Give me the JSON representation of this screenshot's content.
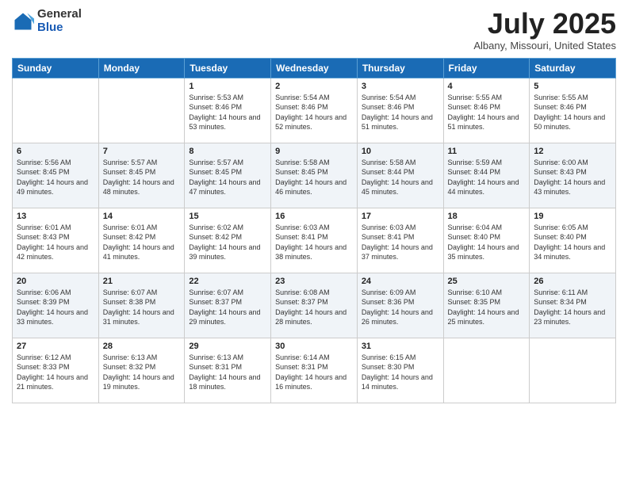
{
  "header": {
    "logo_general": "General",
    "logo_blue": "Blue",
    "month_title": "July 2025",
    "location": "Albany, Missouri, United States"
  },
  "days_of_week": [
    "Sunday",
    "Monday",
    "Tuesday",
    "Wednesday",
    "Thursday",
    "Friday",
    "Saturday"
  ],
  "weeks": [
    [
      {
        "day": "",
        "sunrise": "",
        "sunset": "",
        "daylight": ""
      },
      {
        "day": "",
        "sunrise": "",
        "sunset": "",
        "daylight": ""
      },
      {
        "day": "1",
        "sunrise": "Sunrise: 5:53 AM",
        "sunset": "Sunset: 8:46 PM",
        "daylight": "Daylight: 14 hours and 53 minutes."
      },
      {
        "day": "2",
        "sunrise": "Sunrise: 5:54 AM",
        "sunset": "Sunset: 8:46 PM",
        "daylight": "Daylight: 14 hours and 52 minutes."
      },
      {
        "day": "3",
        "sunrise": "Sunrise: 5:54 AM",
        "sunset": "Sunset: 8:46 PM",
        "daylight": "Daylight: 14 hours and 51 minutes."
      },
      {
        "day": "4",
        "sunrise": "Sunrise: 5:55 AM",
        "sunset": "Sunset: 8:46 PM",
        "daylight": "Daylight: 14 hours and 51 minutes."
      },
      {
        "day": "5",
        "sunrise": "Sunrise: 5:55 AM",
        "sunset": "Sunset: 8:46 PM",
        "daylight": "Daylight: 14 hours and 50 minutes."
      }
    ],
    [
      {
        "day": "6",
        "sunrise": "Sunrise: 5:56 AM",
        "sunset": "Sunset: 8:45 PM",
        "daylight": "Daylight: 14 hours and 49 minutes."
      },
      {
        "day": "7",
        "sunrise": "Sunrise: 5:57 AM",
        "sunset": "Sunset: 8:45 PM",
        "daylight": "Daylight: 14 hours and 48 minutes."
      },
      {
        "day": "8",
        "sunrise": "Sunrise: 5:57 AM",
        "sunset": "Sunset: 8:45 PM",
        "daylight": "Daylight: 14 hours and 47 minutes."
      },
      {
        "day": "9",
        "sunrise": "Sunrise: 5:58 AM",
        "sunset": "Sunset: 8:45 PM",
        "daylight": "Daylight: 14 hours and 46 minutes."
      },
      {
        "day": "10",
        "sunrise": "Sunrise: 5:58 AM",
        "sunset": "Sunset: 8:44 PM",
        "daylight": "Daylight: 14 hours and 45 minutes."
      },
      {
        "day": "11",
        "sunrise": "Sunrise: 5:59 AM",
        "sunset": "Sunset: 8:44 PM",
        "daylight": "Daylight: 14 hours and 44 minutes."
      },
      {
        "day": "12",
        "sunrise": "Sunrise: 6:00 AM",
        "sunset": "Sunset: 8:43 PM",
        "daylight": "Daylight: 14 hours and 43 minutes."
      }
    ],
    [
      {
        "day": "13",
        "sunrise": "Sunrise: 6:01 AM",
        "sunset": "Sunset: 8:43 PM",
        "daylight": "Daylight: 14 hours and 42 minutes."
      },
      {
        "day": "14",
        "sunrise": "Sunrise: 6:01 AM",
        "sunset": "Sunset: 8:42 PM",
        "daylight": "Daylight: 14 hours and 41 minutes."
      },
      {
        "day": "15",
        "sunrise": "Sunrise: 6:02 AM",
        "sunset": "Sunset: 8:42 PM",
        "daylight": "Daylight: 14 hours and 39 minutes."
      },
      {
        "day": "16",
        "sunrise": "Sunrise: 6:03 AM",
        "sunset": "Sunset: 8:41 PM",
        "daylight": "Daylight: 14 hours and 38 minutes."
      },
      {
        "day": "17",
        "sunrise": "Sunrise: 6:03 AM",
        "sunset": "Sunset: 8:41 PM",
        "daylight": "Daylight: 14 hours and 37 minutes."
      },
      {
        "day": "18",
        "sunrise": "Sunrise: 6:04 AM",
        "sunset": "Sunset: 8:40 PM",
        "daylight": "Daylight: 14 hours and 35 minutes."
      },
      {
        "day": "19",
        "sunrise": "Sunrise: 6:05 AM",
        "sunset": "Sunset: 8:40 PM",
        "daylight": "Daylight: 14 hours and 34 minutes."
      }
    ],
    [
      {
        "day": "20",
        "sunrise": "Sunrise: 6:06 AM",
        "sunset": "Sunset: 8:39 PM",
        "daylight": "Daylight: 14 hours and 33 minutes."
      },
      {
        "day": "21",
        "sunrise": "Sunrise: 6:07 AM",
        "sunset": "Sunset: 8:38 PM",
        "daylight": "Daylight: 14 hours and 31 minutes."
      },
      {
        "day": "22",
        "sunrise": "Sunrise: 6:07 AM",
        "sunset": "Sunset: 8:37 PM",
        "daylight": "Daylight: 14 hours and 29 minutes."
      },
      {
        "day": "23",
        "sunrise": "Sunrise: 6:08 AM",
        "sunset": "Sunset: 8:37 PM",
        "daylight": "Daylight: 14 hours and 28 minutes."
      },
      {
        "day": "24",
        "sunrise": "Sunrise: 6:09 AM",
        "sunset": "Sunset: 8:36 PM",
        "daylight": "Daylight: 14 hours and 26 minutes."
      },
      {
        "day": "25",
        "sunrise": "Sunrise: 6:10 AM",
        "sunset": "Sunset: 8:35 PM",
        "daylight": "Daylight: 14 hours and 25 minutes."
      },
      {
        "day": "26",
        "sunrise": "Sunrise: 6:11 AM",
        "sunset": "Sunset: 8:34 PM",
        "daylight": "Daylight: 14 hours and 23 minutes."
      }
    ],
    [
      {
        "day": "27",
        "sunrise": "Sunrise: 6:12 AM",
        "sunset": "Sunset: 8:33 PM",
        "daylight": "Daylight: 14 hours and 21 minutes."
      },
      {
        "day": "28",
        "sunrise": "Sunrise: 6:13 AM",
        "sunset": "Sunset: 8:32 PM",
        "daylight": "Daylight: 14 hours and 19 minutes."
      },
      {
        "day": "29",
        "sunrise": "Sunrise: 6:13 AM",
        "sunset": "Sunset: 8:31 PM",
        "daylight": "Daylight: 14 hours and 18 minutes."
      },
      {
        "day": "30",
        "sunrise": "Sunrise: 6:14 AM",
        "sunset": "Sunset: 8:31 PM",
        "daylight": "Daylight: 14 hours and 16 minutes."
      },
      {
        "day": "31",
        "sunrise": "Sunrise: 6:15 AM",
        "sunset": "Sunset: 8:30 PM",
        "daylight": "Daylight: 14 hours and 14 minutes."
      },
      {
        "day": "",
        "sunrise": "",
        "sunset": "",
        "daylight": ""
      },
      {
        "day": "",
        "sunrise": "",
        "sunset": "",
        "daylight": ""
      }
    ]
  ]
}
